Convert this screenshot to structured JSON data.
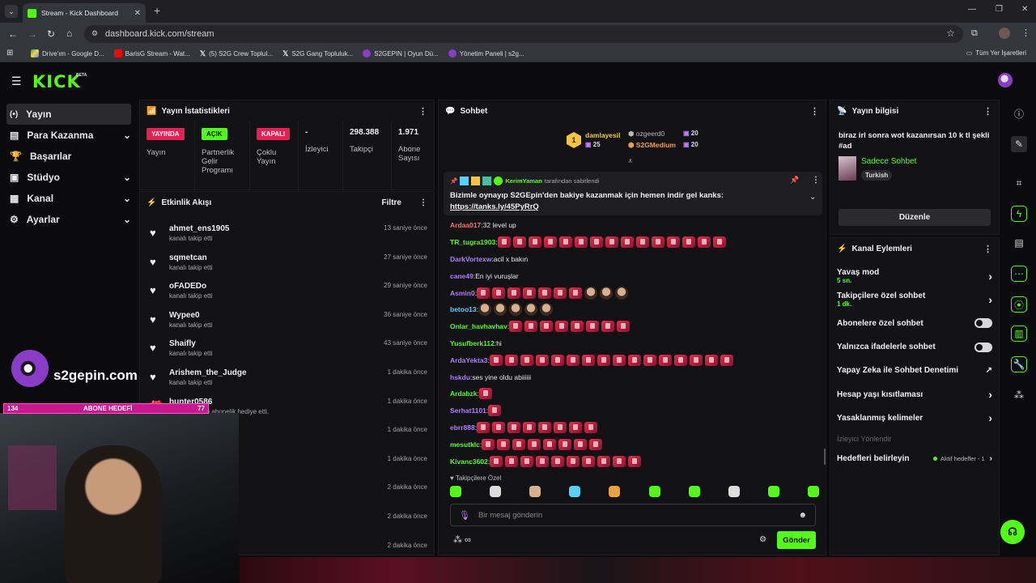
{
  "browser": {
    "tab_title": "Stream - Kick Dashboard",
    "url": "dashboard.kick.com/stream",
    "bookmarks": [
      "Drive'ım - Google D...",
      "BarisG Stream - Wat...",
      "(5) S2G Crew TopluI...",
      "S2G Gang Topluluk...",
      "S2GEPIN | Oyun Dü...",
      "Yönetim Paneli | s2g..."
    ],
    "bookmarks_folder": "Tüm Yer İşaretleri"
  },
  "app": {
    "logo": "KICK",
    "logo_beta": "BETA",
    "accent": "#53fc18"
  },
  "sidebar": {
    "items": [
      {
        "label": "Yayın",
        "icon": "broadcast-icon",
        "chevron": false
      },
      {
        "label": "Para Kazanma",
        "icon": "money-icon",
        "chevron": true
      },
      {
        "label": "Başarılar",
        "icon": "trophy-icon",
        "chevron": false
      },
      {
        "label": "Stüdyo",
        "icon": "studio-icon",
        "chevron": true
      },
      {
        "label": "Kanal",
        "icon": "channel-icon",
        "chevron": true
      },
      {
        "label": "Ayarlar",
        "icon": "settings-icon",
        "chevron": true
      }
    ]
  },
  "stats": {
    "title": "Yayın İstatistikleri",
    "cells": [
      {
        "badge": "YAYINDA",
        "badge_color": "#e91e53",
        "label": "Yayın"
      },
      {
        "badge": "AÇIK",
        "badge_color": "#53fc18",
        "label": "Partnerlik Gelir Programı"
      },
      {
        "badge": "KAPALI",
        "badge_color": "#e91e53",
        "label": "Çoklu Yayın"
      },
      {
        "value": "-",
        "label": "İzleyici"
      },
      {
        "value": "298.388",
        "label": "Takipçi"
      },
      {
        "value": "1.971",
        "label": "Abone Sayısı"
      }
    ]
  },
  "activity": {
    "title": "Etkinlik Akışı",
    "filter": "Filtre",
    "events": [
      {
        "name": "ahmet_ens1905",
        "sub": "kanalı takip etti",
        "time": "13 saniye önce"
      },
      {
        "name": "sqmetcan",
        "sub": "kanalı takip etti",
        "time": "27 saniye önce"
      },
      {
        "name": "oFADEDo",
        "sub": "kanalı takip etti",
        "time": "29 saniye önce"
      },
      {
        "name": "Wypee0",
        "sub": "kanalı takip etti",
        "time": "36 saniye önce"
      },
      {
        "name": "Shaifly",
        "sub": "kanalı takip etti",
        "time": "43 saniye önce"
      },
      {
        "name": "Arishem_the_Judge",
        "sub": "kanalı takip etti",
        "time": "1 dakika önce"
      },
      {
        "name": "hunter0586",
        "sub": "mli kullanıcıya abonelik hediye etti.",
        "time": "1 dakika önce"
      },
      {
        "name": "",
        "sub": "",
        "time": "1 dakika önce"
      },
      {
        "name": "",
        "sub": "",
        "time": "1 dakika önce"
      },
      {
        "name": "",
        "sub": "",
        "time": "2 dakika önce"
      },
      {
        "name": "",
        "sub": "",
        "time": "2 dakika önce"
      },
      {
        "name": "",
        "sub": "",
        "time": "2 dakika önce"
      }
    ]
  },
  "overlay": {
    "brand": "s2gepin.com",
    "goal_current": "134",
    "goal_label": "ABONE HEDEFİ",
    "goal_target": "77"
  },
  "chat": {
    "title": "Sohbet",
    "leaders": [
      {
        "rank": "1",
        "name": "damlayesil",
        "count": "25",
        "color": "#f5c542"
      },
      {
        "name": "ozgeerd0",
        "count": "20",
        "color": "#b8b8be"
      },
      {
        "name": "S2GMedium",
        "count": "20",
        "color": "#f0a040"
      }
    ],
    "pinned_by": "KerimYaman",
    "pinned_by_suffix": "tarafından sabitlendi",
    "pinned_text": "Bizimle oynayıp S2GEpin'den bakiye kazanmak için hemen indir gel kanks:",
    "pinned_link": "https://tanks.ly/45PyRrQ",
    "messages": [
      {
        "user": "Ardaa017",
        "color": "#ff6b6b",
        "text": "32 level up",
        "emotes": 0
      },
      {
        "user": "TR_tugra1903",
        "color": "#53fc18",
        "text": "",
        "emotes": 15
      },
      {
        "user": "DarkVortexw",
        "color": "#b07cff",
        "text": "acil x bakın",
        "emotes": 0
      },
      {
        "user": "cane49",
        "color": "#b07cff",
        "text": "En iyi vuruşlar",
        "emotes": 0
      },
      {
        "user": "Asmin0",
        "color": "#b07cff",
        "text": "",
        "emotes": 10
      },
      {
        "user": "betoo13",
        "color": "#5ad0ff",
        "text": "",
        "emotes": 5
      },
      {
        "user": "Onlar_havhavhav",
        "color": "#53fc18",
        "text": "",
        "emotes": 8
      },
      {
        "user": "Yusufberk112",
        "color": "#53fc18",
        "text": "hi",
        "emotes": 0
      },
      {
        "user": "ArdaYekta3",
        "color": "#b07cff",
        "text": "",
        "emotes": 16
      },
      {
        "user": "hskdu",
        "color": "#b07cff",
        "text": "ses yine oldu abiiiiii",
        "emotes": 0
      },
      {
        "user": "Ardabzk",
        "color": "#53fc18",
        "text": "",
        "emotes": 1
      },
      {
        "user": "Serhat1101",
        "color": "#b07cff",
        "text": "",
        "emotes": 1
      },
      {
        "user": "ebrr888",
        "color": "#b07cff",
        "text": "",
        "emotes": 8
      },
      {
        "user": "mesutklc",
        "color": "#53fc18",
        "text": "",
        "emotes": 8
      },
      {
        "user": "Kivanc3602",
        "color": "#53fc18",
        "text": "",
        "emotes": 10
      }
    ],
    "follower_only_label": "Takipçilere Özel",
    "input_placeholder": "Bir mesaj gönderin",
    "send": "Gönder"
  },
  "info": {
    "title": "Yayın bilgisi",
    "stream_title": "biraz irl sonra wot kazanırsan 10 k tl şekli #ad",
    "category": "Sadece Sohbet",
    "language": "Turkish",
    "edit": "Düzenle"
  },
  "actions": {
    "title": "Kanal Eylemleri",
    "items": [
      {
        "label": "Yavaş mod",
        "sub": "5 sn.",
        "control": "chevron"
      },
      {
        "label": "Takipçilere özel sohbet",
        "sub": "1 dk.",
        "control": "chevron"
      },
      {
        "label": "Abonelere özel sohbet",
        "sub": "",
        "control": "toggle"
      },
      {
        "label": "Yalnızca ifadelerle sohbet",
        "sub": "",
        "control": "toggle"
      },
      {
        "label": "Yapay Zeka ile Sohbet Denetimi",
        "sub": "",
        "control": "external"
      },
      {
        "label": "Hesap yaşı kısıtlaması",
        "sub": "",
        "control": "chevron"
      },
      {
        "label": "Yasaklanmış kelimeler",
        "sub": "",
        "control": "chevron"
      }
    ],
    "section": "İzleyici Yönlendir",
    "goals_label": "Hedefleri belirleyin",
    "goals_status": "Aktif hedefler - 1"
  }
}
